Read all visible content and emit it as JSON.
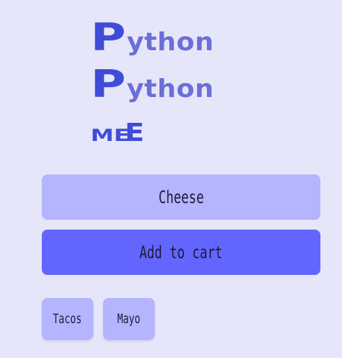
{
  "logo": {
    "line1_cap": "P",
    "line1_rest": "ython",
    "line2_cap": "P",
    "line2_rest": "ython",
    "line3_small": "ME",
    "line3_big": "E",
    "colors": {
      "cap": "#3f4cd8",
      "rest": "#6b6fd6"
    }
  },
  "main": {
    "cheese_button_label": "Cheese",
    "add_to_cart_label": "Add to cart"
  },
  "chips": [
    {
      "label": "Tacos"
    },
    {
      "label": "Mayo"
    }
  ],
  "colors": {
    "background": "#e6e6fa",
    "secondary_button": "#b4b4ff",
    "primary_button": "#6366fe",
    "text": "#1d1b3a"
  }
}
